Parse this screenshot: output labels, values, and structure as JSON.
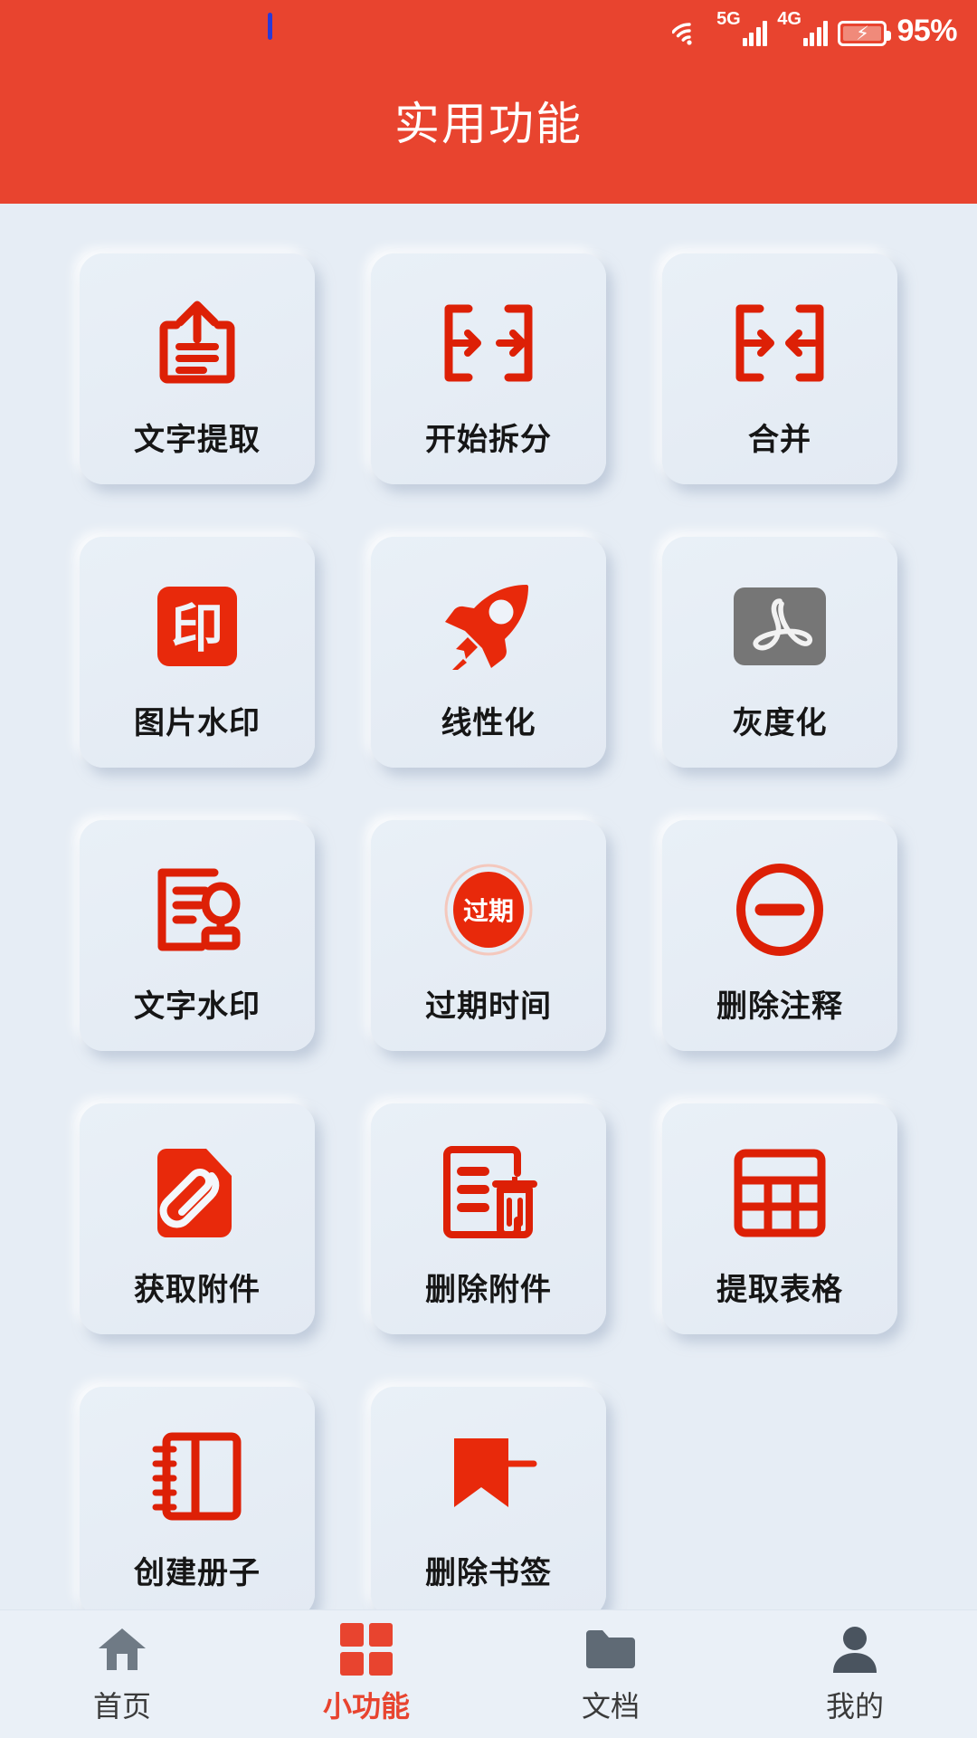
{
  "status_bar": {
    "network_5g": "5G",
    "network_4g": "4G",
    "battery_percent": "95%",
    "wifi_icon": "wifi-icon",
    "battery_icon": "battery-charging-icon"
  },
  "header": {
    "title": "实用功能"
  },
  "colors": {
    "accent": "#e8442f",
    "icon_red": "#dd2006",
    "page_bg": "#e6edf5",
    "card_bg": "#e7eef6",
    "gray_icon": "#767676"
  },
  "grid": {
    "items": [
      {
        "label": "文字提取",
        "icon": "text-extract-icon"
      },
      {
        "label": "开始拆分",
        "icon": "split-icon"
      },
      {
        "label": "合并",
        "icon": "merge-icon"
      },
      {
        "label": "图片水印",
        "icon": "image-watermark-icon",
        "badge_text": "印"
      },
      {
        "label": "线性化",
        "icon": "rocket-icon"
      },
      {
        "label": "灰度化",
        "icon": "pdf-grayscale-icon"
      },
      {
        "label": "文字水印",
        "icon": "text-watermark-icon"
      },
      {
        "label": "过期时间",
        "icon": "expire-stamp-icon",
        "badge_text": "过期"
      },
      {
        "label": "删除注释",
        "icon": "remove-annotation-icon"
      },
      {
        "label": "获取附件",
        "icon": "attachment-get-icon"
      },
      {
        "label": "删除附件",
        "icon": "attachment-delete-icon"
      },
      {
        "label": "提取表格",
        "icon": "table-extract-icon"
      },
      {
        "label": "创建册子",
        "icon": "create-booklet-icon"
      },
      {
        "label": "删除书签",
        "icon": "delete-bookmark-icon"
      }
    ]
  },
  "bottom_nav": {
    "items": [
      {
        "label": "首页",
        "icon": "home-icon",
        "active": false
      },
      {
        "label": "小功能",
        "icon": "grid-apps-icon",
        "active": true
      },
      {
        "label": "文档",
        "icon": "folder-icon",
        "active": false
      },
      {
        "label": "我的",
        "icon": "person-icon",
        "active": false
      }
    ]
  }
}
